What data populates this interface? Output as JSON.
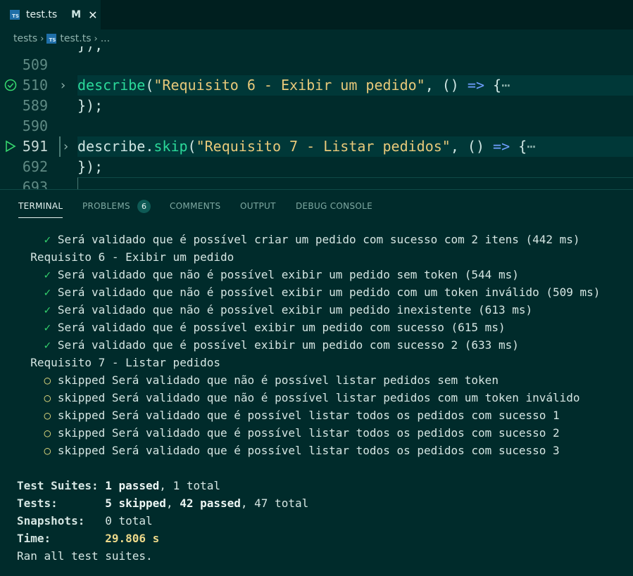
{
  "tab": {
    "filename": "test.ts",
    "modified": "M",
    "close": "✕",
    "icon_text": "TS"
  },
  "breadcrumb": {
    "folder": "tests",
    "file": "test.ts",
    "more": "..."
  },
  "editor": {
    "partial_top": "});",
    "lines": [
      {
        "num": "509",
        "code": ""
      },
      {
        "num": "510",
        "fn": "describe",
        "str": "\"Requisito 6 - Exibir um pedido\"",
        "tail": ", () => {"
      },
      {
        "num": "589",
        "code": "});"
      },
      {
        "num": "590",
        "code": ""
      },
      {
        "num": "591",
        "obj": "describe.",
        "fn": "skip",
        "str": "\"Requisito 7 - Listar pedidos\"",
        "tail": ", () => {"
      },
      {
        "num": "692",
        "code": "});"
      },
      {
        "num": "693",
        "code": ""
      }
    ],
    "ellipsis": "⋯",
    "open_paren": "(",
    "comma_paren": ", () ",
    "arrow": "=>",
    "brace": " {"
  },
  "panel": {
    "tabs": [
      "TERMINAL",
      "PROBLEMS",
      "COMMENTS",
      "OUTPUT",
      "DEBUG CONSOLE"
    ],
    "problems_count": "6"
  },
  "terminal": {
    "check": "✓",
    "circle": "○",
    "line1": "Será validado que é possível criar um pedido com sucesso com 2 itens (442 ms)",
    "group6": "Requisito 6 - Exibir um pedido",
    "g6": [
      "Será validado que não é possível exibir um pedido sem token (544 ms)",
      "Será validado que não é possível exibir um pedido com um token inválido (509 ms)",
      "Será validado que não é possível exibir um pedido inexistente (613 ms)",
      "Será validado que é possível exibir um pedido com sucesso (615 ms)",
      "Será validado que é possível exibir um pedido com sucesso 2 (633 ms)"
    ],
    "group7": "Requisito 7 - Listar pedidos",
    "g7": [
      "skipped Será validado que não é possível listar pedidos sem token",
      "skipped Será validado que não é possível listar pedidos com um token inválido",
      "skipped Será validado que é possível listar todos os pedidos com sucesso 1",
      "skipped Será validado que é possível listar todos os pedidos com sucesso 2",
      "skipped Será validado que é possível listar todos os pedidos com sucesso 3"
    ],
    "summary": {
      "suites_label": "Test Suites:",
      "suites_passed": "1 passed",
      "suites_total": ", 1 total",
      "tests_label": "Tests:",
      "tests_skipped": "5 skipped",
      "tests_passed": "42 passed",
      "tests_total": ", 47 total",
      "snap_label": "Snapshots:",
      "snap_value": "0 total",
      "time_label": "Time:",
      "time_value": "29.806 s",
      "ran": "Ran all test suites."
    }
  }
}
